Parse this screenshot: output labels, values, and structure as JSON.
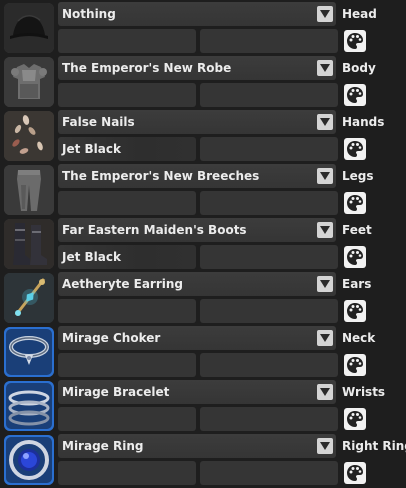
{
  "slots": [
    {
      "item": "Nothing",
      "slot": "Head",
      "dye1": "",
      "dye2": "",
      "icon": "empty-head-icon"
    },
    {
      "item": "The Emperor's New Robe",
      "slot": "Body",
      "dye1": "",
      "dye2": "",
      "icon": "body-armor-icon"
    },
    {
      "item": "False Nails",
      "slot": "Hands",
      "dye1": "Jet Black",
      "dye2": "",
      "icon": "nails-icon"
    },
    {
      "item": "The Emperor's New Breeches",
      "slot": "Legs",
      "dye1": "",
      "dye2": "",
      "icon": "breeches-icon"
    },
    {
      "item": "Far Eastern Maiden's Boots",
      "slot": "Feet",
      "dye1": "Jet Black",
      "dye2": "",
      "icon": "boots-icon"
    },
    {
      "item": "Aetheryte Earring",
      "slot": "Ears",
      "dye1": "",
      "dye2": "",
      "icon": "earring-icon"
    },
    {
      "item": "Mirage Choker",
      "slot": "Neck",
      "dye1": "",
      "dye2": "",
      "icon": "choker-icon"
    },
    {
      "item": "Mirage Bracelet",
      "slot": "Wrists",
      "dye1": "",
      "dye2": "",
      "icon": "bracelet-icon"
    },
    {
      "item": "Mirage Ring",
      "slot": "Right Ring",
      "dye1": "",
      "dye2": "",
      "icon": "ring-icon"
    }
  ]
}
